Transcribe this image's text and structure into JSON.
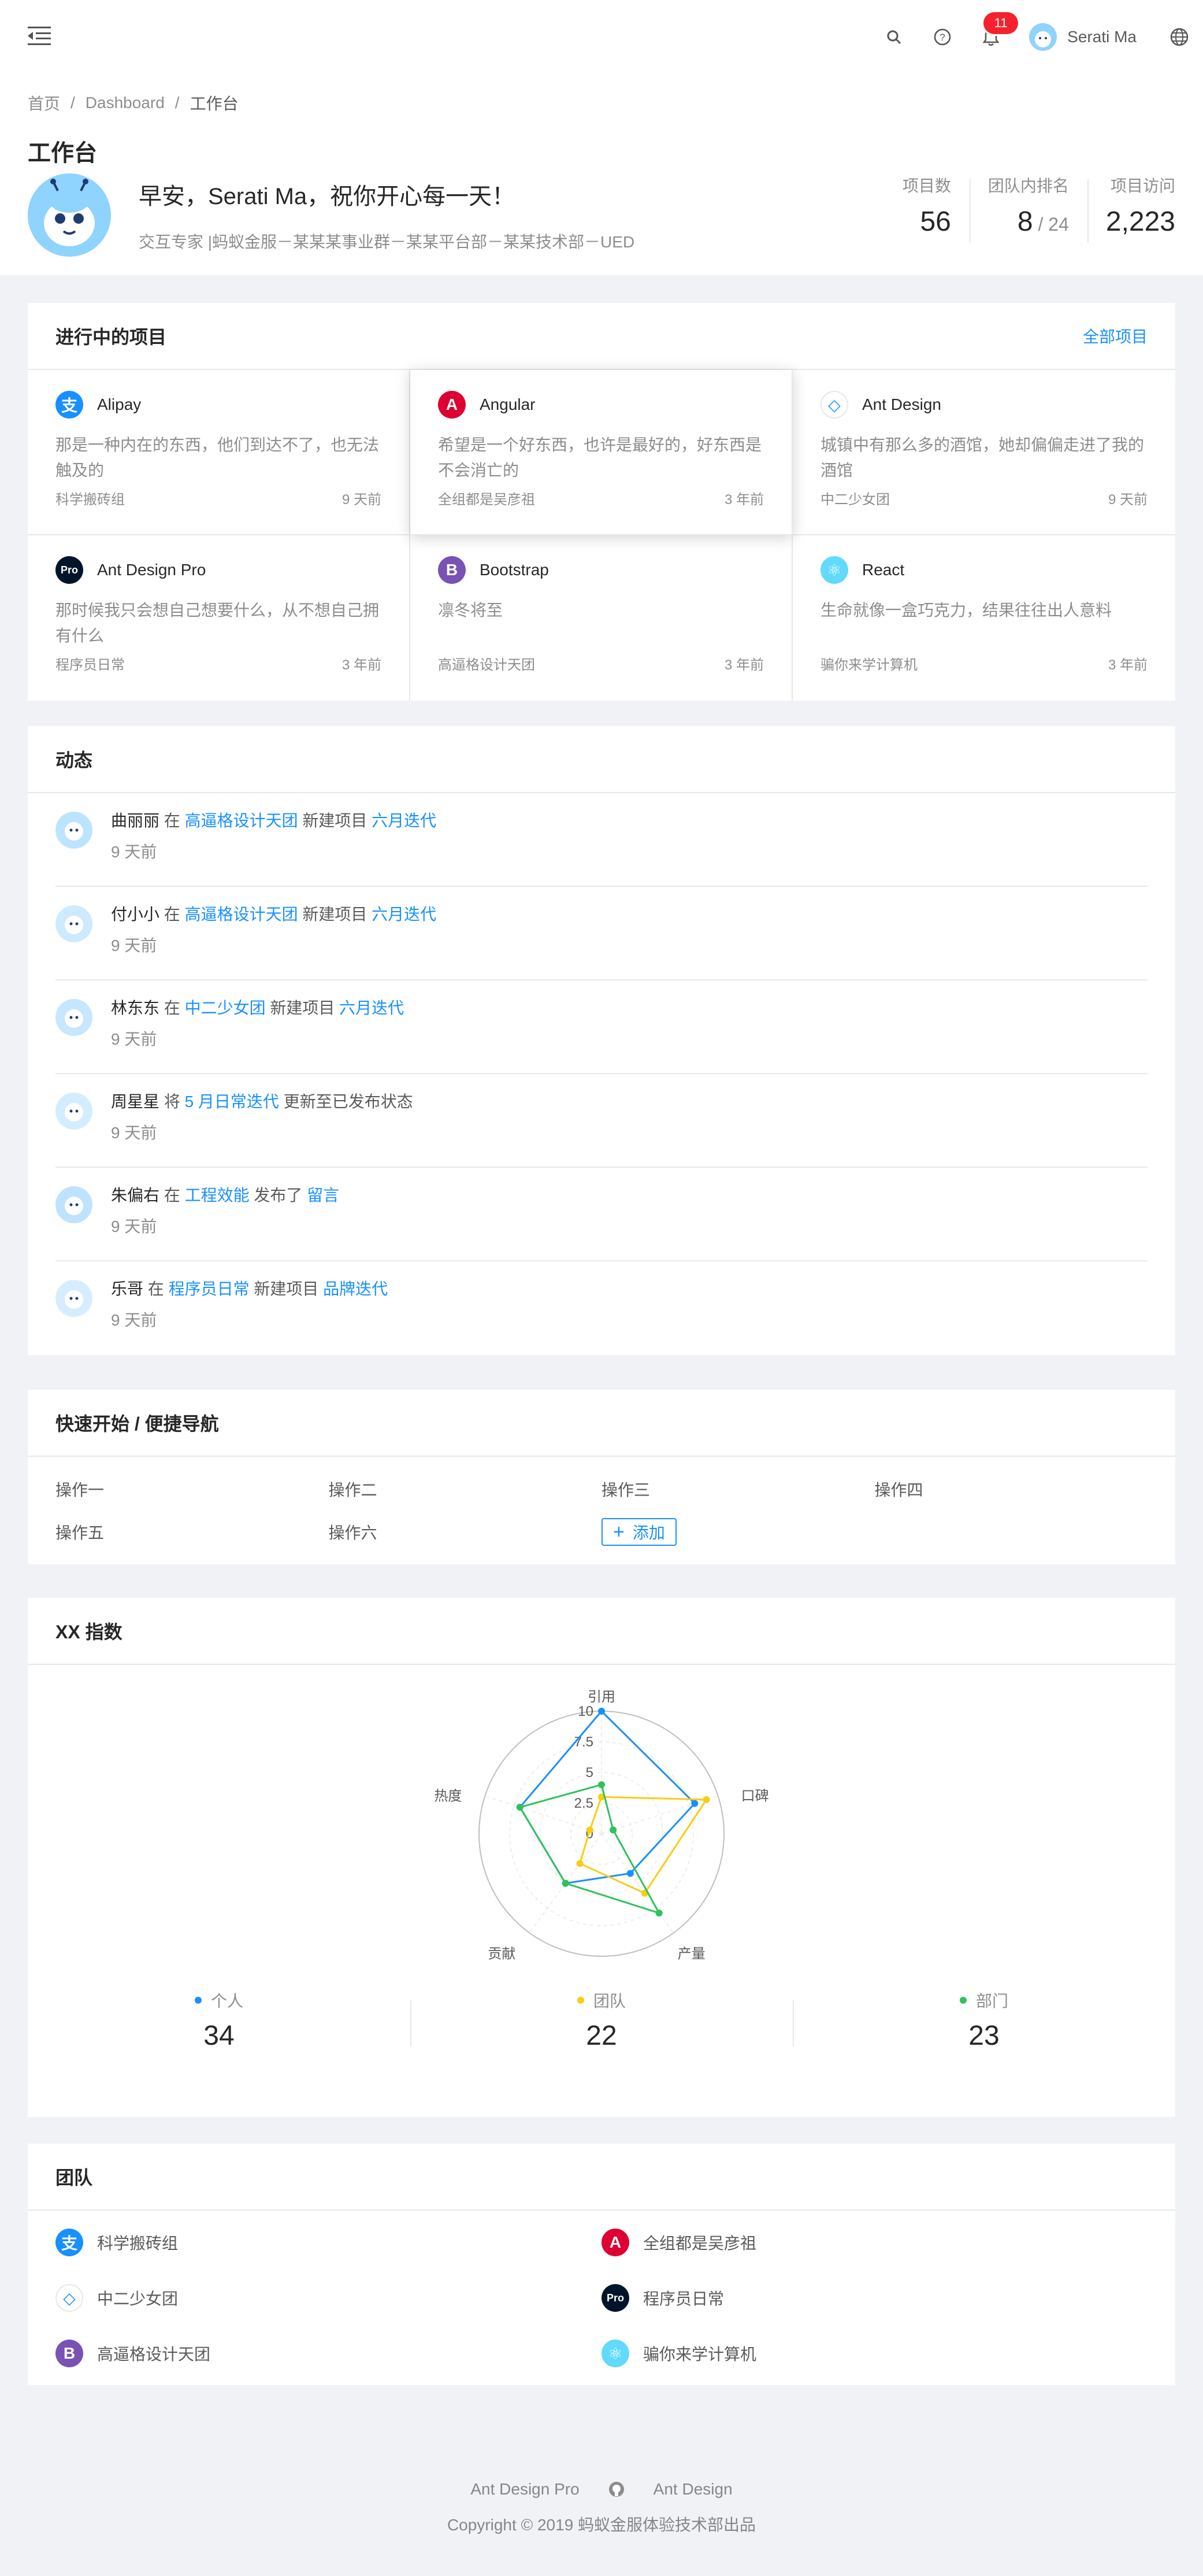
{
  "header": {
    "notification_count": "11",
    "user_name": "Serati Ma"
  },
  "breadcrumb": [
    "首页",
    "Dashboard",
    "工作台"
  ],
  "page_title": "工作台",
  "welcome": {
    "greeting": "早安，Serati Ma，祝你开心每一天！",
    "description": "交互专家 |蚂蚁金服－某某某事业群－某某平台部－某某技术部－UED"
  },
  "stats": {
    "projects": {
      "label": "项目数",
      "value": "56"
    },
    "rank": {
      "label": "团队内排名",
      "value": "8",
      "total": " / 24"
    },
    "visits": {
      "label": "项目访问",
      "value": "2,223"
    }
  },
  "projects_card": {
    "title": "进行中的项目",
    "extra": "全部项目",
    "items": [
      {
        "name": "Alipay",
        "desc": "那是一种内在的东西，他们到达不了，也无法触及的",
        "group": "科学搬砖组",
        "time": "9 天前",
        "logo": "alipay",
        "color": "#1890ff",
        "glyph": "支"
      },
      {
        "name": "Angular",
        "desc": "希望是一个好东西，也许是最好的，好东西是不会消亡的",
        "group": "全组都是吴彦祖",
        "time": "3 年前",
        "logo": "angular",
        "color": "#dd0031",
        "glyph": "A"
      },
      {
        "name": "Ant Design",
        "desc": "城镇中有那么多的酒馆，她却偏偏走进了我的酒馆",
        "group": "中二少女团",
        "time": "9 天前",
        "logo": "ant-design",
        "color": "#ffffff",
        "glyph": "◇"
      },
      {
        "name": "Ant Design Pro",
        "desc": "那时候我只会想自己想要什么，从不想自己拥有什么",
        "group": "程序员日常",
        "time": "3 年前",
        "logo": "ant-design-pro",
        "color": "#001529",
        "glyph": "Pro"
      },
      {
        "name": "Bootstrap",
        "desc": "凛冬将至",
        "group": "高逼格设计天团",
        "time": "3 年前",
        "logo": "bootstrap",
        "color": "#7952b3",
        "glyph": "B"
      },
      {
        "name": "React",
        "desc": "生命就像一盒巧克力，结果往往出人意料",
        "group": "骗你来学计算机",
        "time": "3 年前",
        "logo": "react",
        "color": "#61dafb",
        "glyph": "⚛"
      }
    ]
  },
  "activity_card": {
    "title": "动态",
    "items": [
      {
        "user": "曲丽丽",
        "p1": " 在 ",
        "l1": "高逼格设计天团",
        "p2": " 新建项目 ",
        "l2": "六月迭代",
        "p3": "",
        "time": "9 天前"
      },
      {
        "user": "付小小",
        "p1": " 在 ",
        "l1": "高逼格设计天团",
        "p2": " 新建项目 ",
        "l2": "六月迭代",
        "p3": "",
        "time": "9 天前"
      },
      {
        "user": "林东东",
        "p1": " 在 ",
        "l1": "中二少女团",
        "p2": " 新建项目 ",
        "l2": "六月迭代",
        "p3": "",
        "time": "9 天前"
      },
      {
        "user": "周星星",
        "p1": " 将 ",
        "l1": "5 月日常迭代",
        "p2": " 更新至已发布状态",
        "l2": "",
        "p3": "",
        "time": "9 天前"
      },
      {
        "user": "朱偏右",
        "p1": " 在 ",
        "l1": "工程效能",
        "p2": " 发布了 ",
        "l2": "留言",
        "p3": "",
        "time": "9 天前"
      },
      {
        "user": "乐哥",
        "p1": " 在 ",
        "l1": "程序员日常",
        "p2": " 新建项目 ",
        "l2": "品牌迭代",
        "p3": "",
        "time": "9 天前"
      }
    ]
  },
  "quick_card": {
    "title": "快速开始 / 便捷导航",
    "links": [
      "操作一",
      "操作二",
      "操作三",
      "操作四",
      "操作五",
      "操作六"
    ],
    "add_label": "添加"
  },
  "radar_card": {
    "title": "XX 指数",
    "legend": [
      {
        "name": "个人",
        "value": "34",
        "color": "#1890ff"
      },
      {
        "name": "团队",
        "value": "22",
        "color": "#facc14"
      },
      {
        "name": "部门",
        "value": "23",
        "color": "#2fc25b"
      }
    ]
  },
  "chart_data": {
    "type": "radar",
    "title": "XX 指数",
    "axes": [
      "引用",
      "口碑",
      "产量",
      "贡献",
      "热度"
    ],
    "ticks": [
      "0",
      "2.5",
      "5",
      "7.5",
      "10"
    ],
    "range": [
      0,
      10
    ],
    "series": [
      {
        "name": "个人",
        "color": "#1890ff",
        "values": [
          10,
          8,
          4,
          5,
          7
        ]
      },
      {
        "name": "团队",
        "color": "#facc14",
        "values": [
          3,
          9,
          6,
          3,
          1
        ]
      },
      {
        "name": "部门",
        "color": "#2fc25b",
        "values": [
          4,
          1,
          8,
          5,
          7
        ]
      }
    ]
  },
  "team_card": {
    "title": "团队",
    "items": [
      {
        "name": "科学搬砖组",
        "logo": "alipay",
        "color": "#1890ff",
        "glyph": "支"
      },
      {
        "name": "全组都是吴彦祖",
        "logo": "angular",
        "color": "#dd0031",
        "glyph": "A"
      },
      {
        "name": "中二少女团",
        "logo": "ant-design",
        "color": "#ffffff",
        "glyph": "◇"
      },
      {
        "name": "程序员日常",
        "logo": "ant-design-pro",
        "color": "#001529",
        "glyph": "Pro"
      },
      {
        "name": "高逼格设计天团",
        "logo": "bootstrap",
        "color": "#7952b3",
        "glyph": "B"
      },
      {
        "name": "骗你来学计算机",
        "logo": "react",
        "color": "#61dafb",
        "glyph": "⚛"
      }
    ]
  },
  "footer": {
    "link1": "Ant Design Pro",
    "link2": "Ant Design",
    "copyright": "Copyright © 2019 蚂蚁金服体验技术部出品"
  }
}
